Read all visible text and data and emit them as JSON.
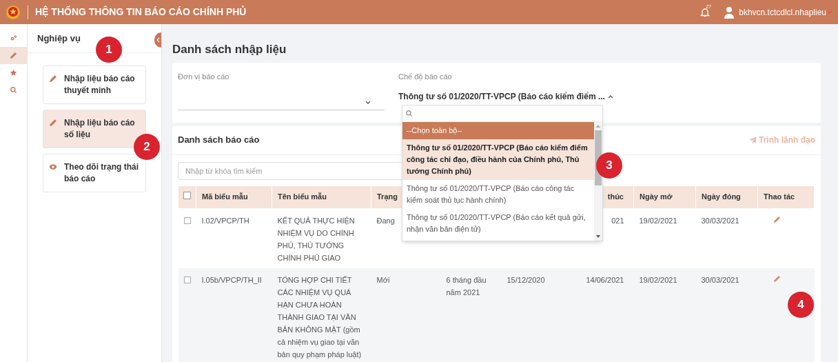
{
  "header": {
    "title": "HỆ THỐNG THÔNG TIN BÁO CÁO CHÍNH PHỦ",
    "notification_count": "27",
    "username": "bkhvcn.tctcdlcl.nhaplieu"
  },
  "rail": [
    {
      "kind": "gears",
      "selected": false
    },
    {
      "kind": "pencil",
      "selected": true
    },
    {
      "kind": "star",
      "selected": false
    },
    {
      "kind": "search",
      "selected": false
    }
  ],
  "sidebar": {
    "title": "Nghiệp vụ",
    "items": [
      {
        "kind": "pencil",
        "label": "Nhập liệu báo cáo thuyết minh",
        "selected": false
      },
      {
        "kind": "pencil",
        "label": "Nhập liệu báo cáo số liệu",
        "selected": true
      },
      {
        "kind": "eye",
        "label": "Theo dõi trạng thái báo cáo",
        "selected": false
      }
    ]
  },
  "page_title": "Danh sách nhập liệu",
  "filters": [
    {
      "label": "Đơn vị báo cáo",
      "expanded": false
    },
    {
      "label": "Chế độ báo cáo",
      "value": "Thông tư số 01/2020/TT-VPCP (Báo cáo kiểm điểm ...",
      "expanded": true
    }
  ],
  "dropdown": {
    "options": [
      {
        "label": "--Chọn toàn bộ--",
        "highlighted": true,
        "selected": false
      },
      {
        "label": "Thông tư số 01/2020/TT-VPCP (Báo cáo kiểm điểm công tác chỉ đạo, điều hành của Chính phủ, Thủ tướng Chính phủ)",
        "highlighted": false,
        "selected": true
      },
      {
        "label": "Thông tư số 01/2020/TT-VPCP (Báo cáo công tác kiểm soát thủ tục hành chính)",
        "highlighted": false,
        "selected": false
      },
      {
        "label": "Thông tư số 01/2020/TT-VPCP (Báo cáo kết quả gửi, nhận văn bản điện tử)",
        "highlighted": false,
        "selected": false
      }
    ]
  },
  "report_list": {
    "title": "Danh sách báo cáo",
    "action": "Trình lãnh đạo",
    "search_placeholder": "Nhập từ khóa tìm kiếm",
    "header_checked": false,
    "headers": {
      "column_1": "Mã biểu mẫu",
      "column_2": "Tên biểu mẫu",
      "column_3": "Trạng",
      "column_6": "thúc",
      "column_7": "Ngày mở",
      "column_8": "Ngày đóng",
      "column_9": "Thao tác"
    },
    "rows": [
      {
        "checked": false,
        "cells": {
          "column_1": "I.02/VPCP/TH",
          "column_2": "KẾT QUẢ THỰC HIỆN NHIỆM VỤ DO CHÍNH PHỦ, THỦ TƯỚNG CHÍNH PHỦ GIAO",
          "column_3": "Đang",
          "column_6": "021",
          "column_7": "19/02/2021",
          "column_8": "30/03/2021"
        }
      },
      {
        "checked": false,
        "cells": {
          "column_1": "I.05b/VPCP/TH_II",
          "column_2": "TỔNG HỢP CHI TIẾT CÁC NHIỆM VỤ QUÁ HẠN CHƯA HOÀN THÀNH GIAO TẠI VĂN BẢN KHÔNG MẬT (gồm cả nhiệm vụ giao tại văn bản quy phạm pháp luật)",
          "column_3": "Mới",
          "column_4": "6 tháng đầu năm 2021",
          "column_5": "15/12/2020",
          "column_6": "14/06/2021",
          "column_7": "19/02/2021",
          "column_8": "30/03/2021"
        }
      }
    ]
  },
  "annotations": [
    "1",
    "2",
    "3",
    "4"
  ]
}
